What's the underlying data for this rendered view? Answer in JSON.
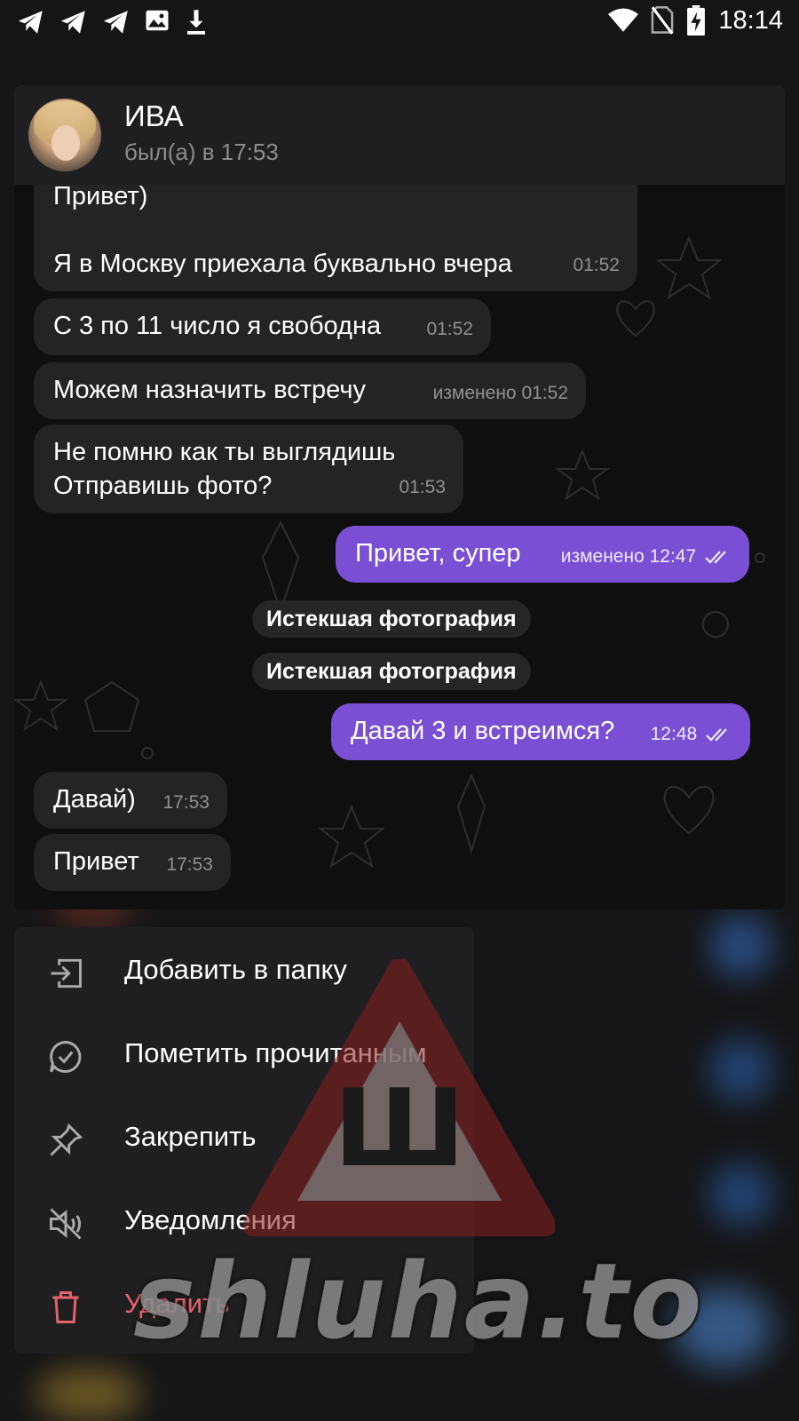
{
  "status_bar": {
    "time": "18:14",
    "left_icons": [
      "telegram-icon",
      "telegram-icon",
      "telegram-icon",
      "image-icon",
      "download-icon"
    ],
    "right_icons": [
      "wifi-icon",
      "no-sim-icon",
      "battery-charging-icon"
    ]
  },
  "chat": {
    "name": "ИВА",
    "status": "был(а) в 17:53",
    "messages": [
      {
        "dir": "in",
        "lines": [
          "Привет)",
          "",
          "Я в Москву приехала буквально вчера"
        ],
        "time": "01:52"
      },
      {
        "dir": "in",
        "lines": [
          "С 3 по 11 число я свободна"
        ],
        "time": "01:52"
      },
      {
        "dir": "in",
        "lines": [
          "Можем назначить встречу"
        ],
        "time": "изменено 01:52"
      },
      {
        "dir": "in",
        "lines": [
          "Не помню как ты выглядишь",
          "Отправишь фото?"
        ],
        "time": "01:53"
      },
      {
        "dir": "out",
        "lines": [
          "Привет, супер"
        ],
        "time": "изменено 12:47",
        "read": true
      },
      {
        "dir": "service",
        "text": "Истекшая фотография"
      },
      {
        "dir": "service",
        "text": "Истекшая фотография"
      },
      {
        "dir": "out",
        "lines": [
          "Давай 3 и встреимся?"
        ],
        "time": "12:48",
        "read": true
      },
      {
        "dir": "in",
        "lines": [
          "Давай)"
        ],
        "time": "17:53"
      },
      {
        "dir": "in",
        "lines": [
          "Привет"
        ],
        "time": "17:53"
      }
    ]
  },
  "menu": {
    "items": [
      {
        "label": "Добавить в папку",
        "icon": "folder-add-icon"
      },
      {
        "label": "Пометить прочитанным",
        "icon": "mark-read-icon"
      },
      {
        "label": "Закрепить",
        "icon": "pin-icon"
      },
      {
        "label": "Уведомления",
        "icon": "mute-icon"
      },
      {
        "label": "Удалить",
        "icon": "trash-icon",
        "danger": true
      }
    ]
  },
  "watermark": {
    "text": "shluha.to",
    "sign_letter": "Ш"
  },
  "colors": {
    "outgoing_bubble": "#7a4fd3",
    "incoming_bubble": "#242426",
    "danger": "#e8626a",
    "background": "#151517"
  }
}
